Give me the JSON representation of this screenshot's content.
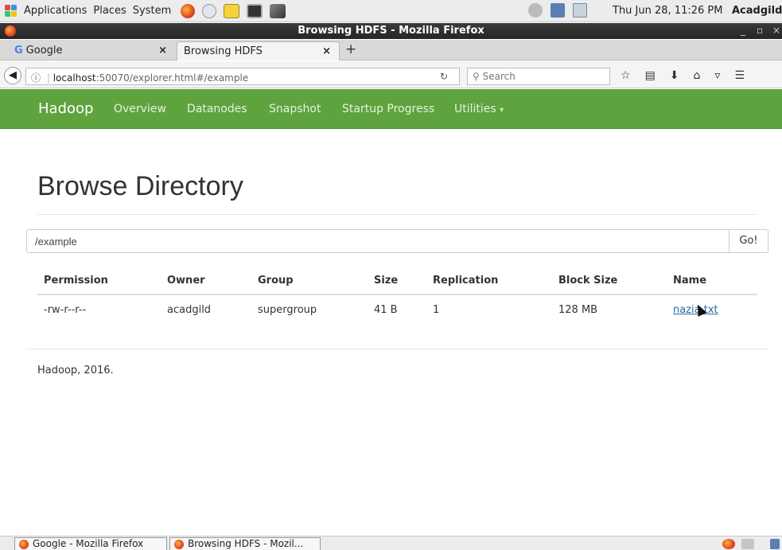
{
  "system_panel": {
    "menus": [
      "Applications",
      "Places",
      "System"
    ],
    "clock": "Thu Jun 28, 11:26 PM",
    "user": "Acadgild"
  },
  "window": {
    "title": "Browsing HDFS - Mozilla Firefox",
    "controls": [
      "_",
      "▫",
      "×"
    ]
  },
  "tabs": [
    {
      "label": "Google",
      "close": "×"
    },
    {
      "label": "Browsing HDFS",
      "close": "×"
    }
  ],
  "new_tab": "+",
  "address": {
    "info_icon": "ⓘ",
    "host": "localhost",
    "path": ":50070/explorer.html#/example",
    "search_placeholder": "Search"
  },
  "hadoop_nav": {
    "brand": "Hadoop",
    "items": [
      "Overview",
      "Datanodes",
      "Snapshot",
      "Startup Progress",
      "Utilities"
    ]
  },
  "page": {
    "title": "Browse Directory",
    "directory_value": "/example",
    "go_label": "Go!",
    "footer": "Hadoop, 2016."
  },
  "table": {
    "headers": [
      "Permission",
      "Owner",
      "Group",
      "Size",
      "Replication",
      "Block Size",
      "Name"
    ],
    "rows": [
      [
        "-rw-r--r--",
        "acadgild",
        "supergroup",
        "41 B",
        "1",
        "128 MB",
        "nazia.txt"
      ]
    ]
  },
  "taskbar": {
    "tasks": [
      "Google - Mozilla Firefox",
      "Browsing HDFS - Mozil..."
    ]
  },
  "colors": {
    "hadoop_green": "#5fa33e",
    "link": "#2a6aa8"
  }
}
